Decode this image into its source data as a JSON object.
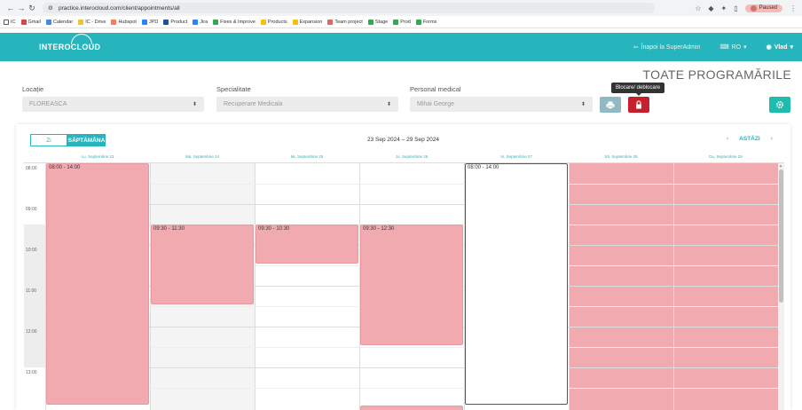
{
  "browser": {
    "url": "practice.interocloud.com/client/appointments/all",
    "paused_label": "Paused",
    "bookmarks": [
      "IC",
      "Gmail",
      "Calendar",
      "IC - Drive",
      "Hubspot",
      "JPD",
      "Product",
      "Jira",
      "Fixes & Improve",
      "Products",
      "Expansion",
      "Team project",
      "Stage",
      "Prod",
      "Forms"
    ]
  },
  "header": {
    "logo": "INTEROCLOUD",
    "back_label": "Înapoi la SuperAdmin",
    "lang_label": "RO",
    "user_label": "Vlad"
  },
  "page": {
    "title": "TOATE PROGRAMĂRILE"
  },
  "filters": {
    "location_label": "Locație",
    "location_value": "FLOREASCA",
    "specialty_label": "Specialitate",
    "specialty_value": "Recuperare Medicala",
    "staff_label": "Personal medical",
    "staff_value": "Mihai George",
    "tooltip": "Blocare/ deblocare"
  },
  "calendar": {
    "view_day": "Zi",
    "view_week": "SĂPTĂMÂNA",
    "date_range": "23 Sep 2024 – 29 Sep 2024",
    "today_label": "ASTĂZI",
    "days": [
      "Lu, Septembrie 23",
      "Ma, Septembrie 24",
      "Mi, Septembrie 25",
      "Jo, Septembrie 26",
      "Vi, Septembrie 27",
      "Sâ, Septembrie 28",
      "Du, Septembrie 29"
    ],
    "hours": [
      "08:00",
      "09:00",
      "10:00",
      "11:00",
      "12:00",
      "13:00"
    ],
    "events": [
      {
        "label": "08:00 - 14:00"
      },
      {
        "label": "09:30 - 11:30"
      },
      {
        "label": "09:30 - 10:30"
      },
      {
        "label": "09:30 - 12:30"
      },
      {
        "label": "08:00 - 14:00"
      }
    ]
  },
  "colors": {
    "brand": "#26b5bc",
    "event": "#f2aab1",
    "lock": "#c7202d"
  }
}
